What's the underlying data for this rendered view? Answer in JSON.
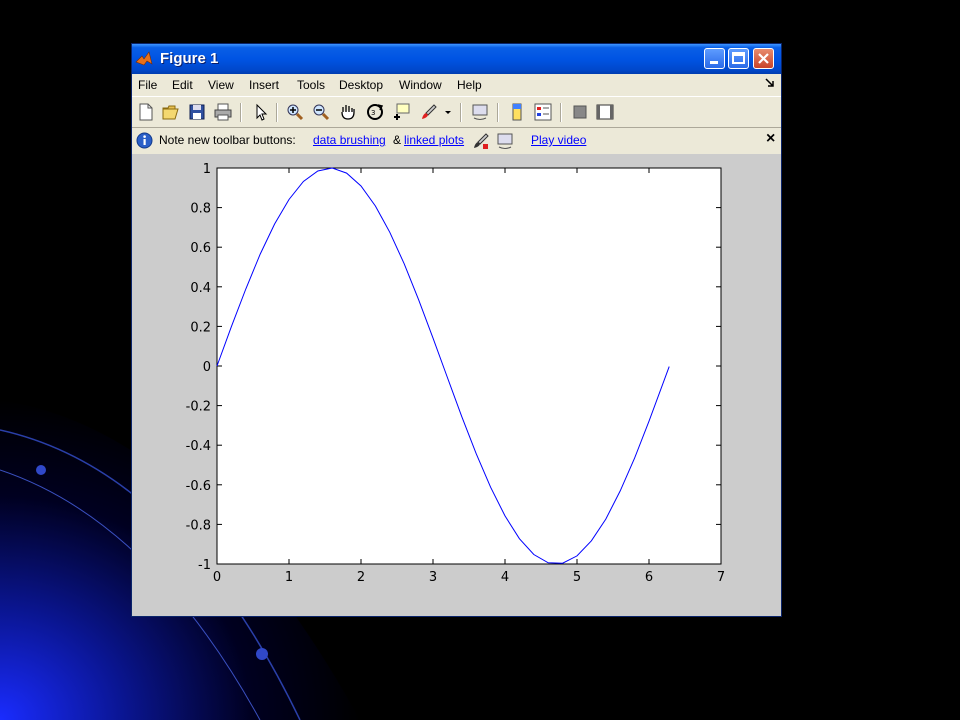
{
  "window": {
    "title": "Figure 1"
  },
  "menubar": {
    "items": [
      "File",
      "Edit",
      "View",
      "Insert",
      "Tools",
      "Desktop",
      "Window",
      "Help"
    ]
  },
  "toolbar": {
    "buttons": [
      "new-figure",
      "open-file",
      "save-figure",
      "print-figure",
      "edit-plot",
      "zoom-in",
      "zoom-out",
      "pan",
      "rotate-3d",
      "data-cursor",
      "brush",
      "link-plot",
      "colorbar",
      "legend",
      "hide-plot-tools",
      "show-plot-tools"
    ]
  },
  "infobar": {
    "note": "Note new toolbar buttons:",
    "link_brushing": "data brushing",
    "amp": "&",
    "link_linked": "linked plots",
    "link_video": "Play video",
    "close": "×"
  },
  "colors": {
    "line": "#0000ff",
    "figure_bg": "#cccccc",
    "titlebar": "#0054e3"
  },
  "chart_data": {
    "type": "line",
    "xlim": [
      0,
      7
    ],
    "ylim": [
      -1,
      1
    ],
    "xticks": [
      "0",
      "1",
      "2",
      "3",
      "4",
      "5",
      "6",
      "7"
    ],
    "yticks": [
      "-1",
      "-0.8",
      "-0.6",
      "-0.4",
      "-0.2",
      "0",
      "0.2",
      "0.4",
      "0.6",
      "0.8",
      "1"
    ],
    "grid": false,
    "series": [
      {
        "x": [
          0,
          0.2,
          0.4,
          0.6,
          0.8,
          1.0,
          1.2,
          1.4,
          1.6,
          1.8,
          2.0,
          2.2,
          2.4,
          2.6,
          2.8,
          3.0,
          3.2,
          3.4,
          3.6,
          3.8,
          4.0,
          4.2,
          4.4,
          4.6,
          4.8,
          5.0,
          5.2,
          5.4,
          5.6,
          5.8,
          6.0,
          6.28
        ],
        "y": [
          0,
          0.199,
          0.389,
          0.565,
          0.717,
          0.841,
          0.932,
          0.985,
          1.0,
          0.974,
          0.909,
          0.808,
          0.675,
          0.516,
          0.335,
          0.141,
          -0.058,
          -0.256,
          -0.443,
          -0.612,
          -0.757,
          -0.872,
          -0.952,
          -0.994,
          -0.996,
          -0.959,
          -0.883,
          -0.773,
          -0.631,
          -0.465,
          -0.279,
          -0.003
        ]
      }
    ]
  }
}
